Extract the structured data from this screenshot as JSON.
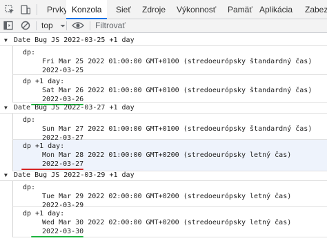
{
  "devtools": {
    "tabs": [
      {
        "label": "Prvky",
        "active": false
      },
      {
        "label": "Konzola",
        "active": true
      },
      {
        "label": "Sieť",
        "active": false
      },
      {
        "label": "Zdroje",
        "active": false
      },
      {
        "label": "Výkonnosť",
        "active": false
      },
      {
        "label": "Pamäť",
        "active": false
      },
      {
        "label": "Aplikácia",
        "active": false
      },
      {
        "label": "Zabez",
        "active": false
      }
    ],
    "icons": {
      "inspect": "cursor-select-icon",
      "device": "device-toolbar-icon",
      "sidebar": "sidebar-toggle-icon",
      "clear": "clear-console-icon",
      "context_dropdown": "chevron-down-icon",
      "live_expression": "eye-icon"
    },
    "accent_color": "#1a73e8"
  },
  "console_toolbar": {
    "context": "top",
    "filter_placeholder": "Filtrovať"
  },
  "logs": [
    {
      "group_title": "Date Bug JS 2022-03-25 +1 day",
      "entries": [
        {
          "label": "dp:",
          "date_string": "Fri Mar 25 2022 01:00:00 GMT+0100 (stredoeurópsky štandardný čas)",
          "iso": "2022-03-25",
          "underline": null,
          "highlighted": false
        },
        {
          "label": "dp +1 day:",
          "date_string": "Sat Mar 26 2022 01:00:00 GMT+0100 (stredoeurópsky štandardný čas)",
          "iso": "2022-03-26",
          "underline": "#1db33e",
          "highlighted": false
        }
      ]
    },
    {
      "group_title": "Date Bug JS 2022-03-27 +1 day",
      "entries": [
        {
          "label": "dp:",
          "date_string": "Sun Mar 27 2022 01:00:00 GMT+0100 (stredoeurópsky štandardný čas)",
          "iso": "2022-03-27",
          "underline": null,
          "highlighted": false
        },
        {
          "label": "dp +1 day:",
          "date_string": "Mon Mar 28 2022 01:00:00 GMT+0200 (stredoeurópsky letný čas)",
          "iso": "2022-03-27",
          "underline": "#d62424",
          "highlighted": true
        }
      ]
    },
    {
      "group_title": "Date Bug JS 2022-03-29 +1 day",
      "entries": [
        {
          "label": "dp:",
          "date_string": "Tue Mar 29 2022 02:00:00 GMT+0200 (stredoeurópsky letný čas)",
          "iso": "2022-03-29",
          "underline": null,
          "highlighted": false
        },
        {
          "label": "dp +1 day:",
          "date_string": "Wed Mar 30 2022 02:00:00 GMT+0200 (stredoeurópsky letný čas)",
          "iso": "2022-03-30",
          "underline": "#1db33e",
          "highlighted": false
        }
      ]
    }
  ]
}
